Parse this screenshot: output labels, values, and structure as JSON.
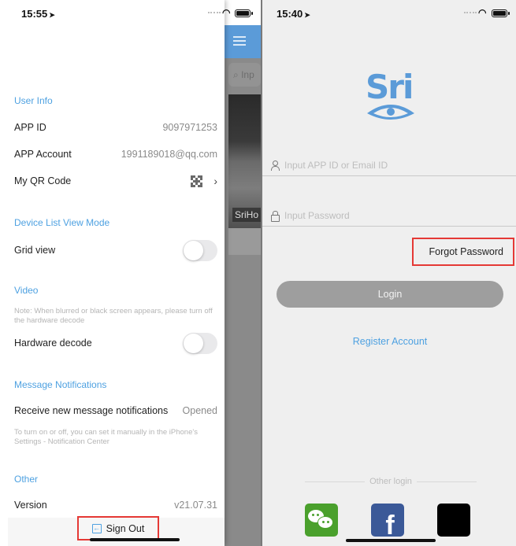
{
  "left_screen": {
    "status_bar": {
      "time": "15:55",
      "location_icon": "location-arrow-icon"
    },
    "sections": {
      "user_info": {
        "title": "User Info",
        "app_id_label": "APP ID",
        "app_id_value": "9097971253",
        "app_account_label": "APP Account",
        "app_account_value": "1991189018@qq.com",
        "qr_code_label": "My QR Code"
      },
      "device_list": {
        "title": "Device List View Mode",
        "grid_view_label": "Grid view",
        "grid_view_on": false
      },
      "video": {
        "title": "Video",
        "note": "Note: When blurred or black screen appears, please turn off the hardware decode",
        "hardware_decode_label": "Hardware decode",
        "hardware_decode_on": false
      },
      "message_notifications": {
        "title": "Message Notifications",
        "receive_label": "Receive new message notifications",
        "receive_value": "Opened",
        "note": "To turn on or off, you can set it manually in the iPhone's Settings - Notification Center"
      },
      "other": {
        "title": "Other",
        "version_label": "Version",
        "version_value": "v21.07.31"
      }
    },
    "sign_out_label": "Sign Out",
    "background_app": {
      "search_placeholder": "Inp",
      "camera_label": "SriHo"
    }
  },
  "right_screen": {
    "status_bar": {
      "time": "15:40"
    },
    "logo_text": "Sri",
    "account_placeholder": "Input APP ID or Email ID",
    "password_placeholder": "Input Password",
    "forgot_password_label": "Forgot Password",
    "login_label": "Login",
    "register_label": "Register Account",
    "other_login_label": "Other login",
    "social_logins": [
      "WeChat",
      "Facebook",
      "Apple"
    ]
  },
  "colors": {
    "accent": "#4ea1e1",
    "highlight_box": "#e53935",
    "wechat": "#4aa02c",
    "facebook": "#3b5998"
  }
}
